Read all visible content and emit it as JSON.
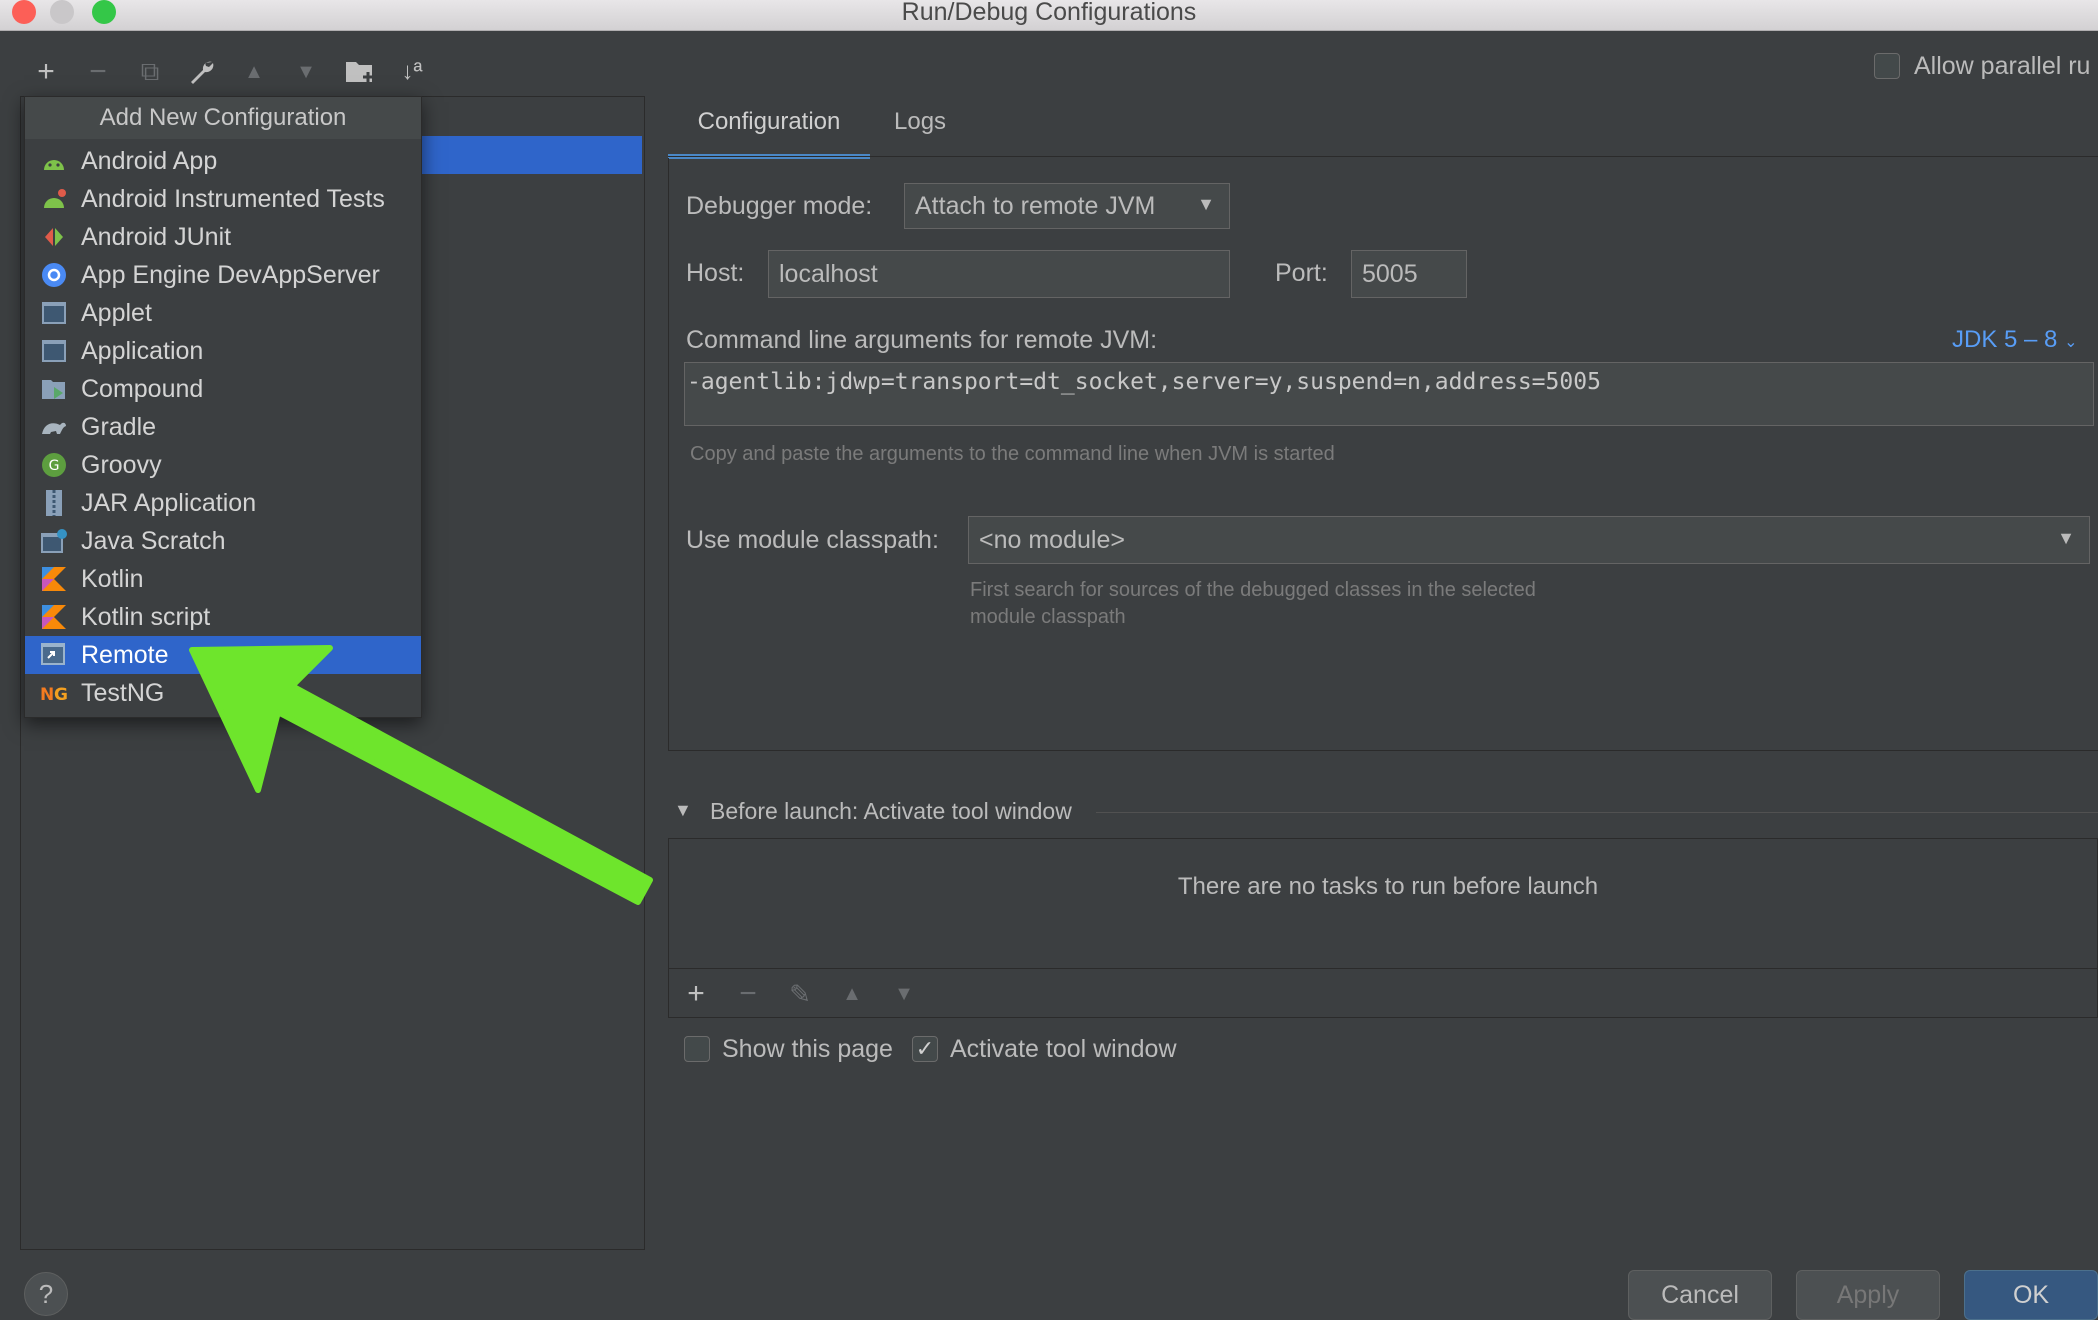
{
  "window": {
    "title": "Run/Debug Configurations"
  },
  "toolbar": {
    "add": "+",
    "remove": "−",
    "copy": "⧉",
    "edit": "🔧",
    "up": "▲",
    "down": "▼",
    "folder": "📁",
    "sort": "↓ª"
  },
  "allow_parallel": {
    "label": "Allow parallel ru"
  },
  "add_menu": {
    "header": "Add New Configuration",
    "items": [
      {
        "label": "Android App",
        "icon": "android-icon"
      },
      {
        "label": "Android Instrumented Tests",
        "icon": "android-test-icon"
      },
      {
        "label": "Android JUnit",
        "icon": "junit-icon"
      },
      {
        "label": "App Engine DevAppServer",
        "icon": "app-engine-icon"
      },
      {
        "label": "Applet",
        "icon": "applet-icon"
      },
      {
        "label": "Application",
        "icon": "application-icon"
      },
      {
        "label": "Compound",
        "icon": "compound-icon"
      },
      {
        "label": "Gradle",
        "icon": "gradle-icon"
      },
      {
        "label": "Groovy",
        "icon": "groovy-icon"
      },
      {
        "label": "JAR Application",
        "icon": "jar-icon"
      },
      {
        "label": "Java Scratch",
        "icon": "java-scratch-icon"
      },
      {
        "label": "Kotlin",
        "icon": "kotlin-icon"
      },
      {
        "label": "Kotlin script",
        "icon": "kotlin-script-icon"
      },
      {
        "label": "Remote",
        "icon": "remote-icon",
        "selected": true
      },
      {
        "label": "TestNG",
        "icon": "testng-icon"
      }
    ]
  },
  "tabs": [
    {
      "label": "Configuration",
      "active": true
    },
    {
      "label": "Logs",
      "active": false
    }
  ],
  "config": {
    "debugger_mode_label": "Debugger mode:",
    "debugger_mode_value": "Attach to remote JVM",
    "host_label": "Host:",
    "host_value": "localhost",
    "port_label": "Port:",
    "port_value": "5005",
    "cmd_label": "Command line arguments for remote JVM:",
    "jdk_link": "JDK 5 – 8",
    "cmd_value": "-agentlib:jdwp=transport=dt_socket,server=y,suspend=n,address=5005",
    "cmd_hint": "Copy and paste the arguments to the command line when JVM is started",
    "module_label": "Use module classpath:",
    "module_value": "<no module>",
    "module_hint_1": "First search for sources of the debugged classes in the selected",
    "module_hint_2": "module classpath"
  },
  "before_launch": {
    "title": "Before launch: Activate tool window",
    "empty_text": "There are no tasks to run before launch",
    "show_page_label": "Show this page",
    "show_page_checked": false,
    "activate_label": "Activate tool window",
    "activate_checked": true
  },
  "buttons": {
    "help": "?",
    "cancel": "Cancel",
    "apply": "Apply",
    "ok": "OK"
  },
  "colors": {
    "selection": "#2f65ca",
    "accent": "#4a88c7",
    "arrow": "#6ee52c",
    "link": "#589df6"
  }
}
